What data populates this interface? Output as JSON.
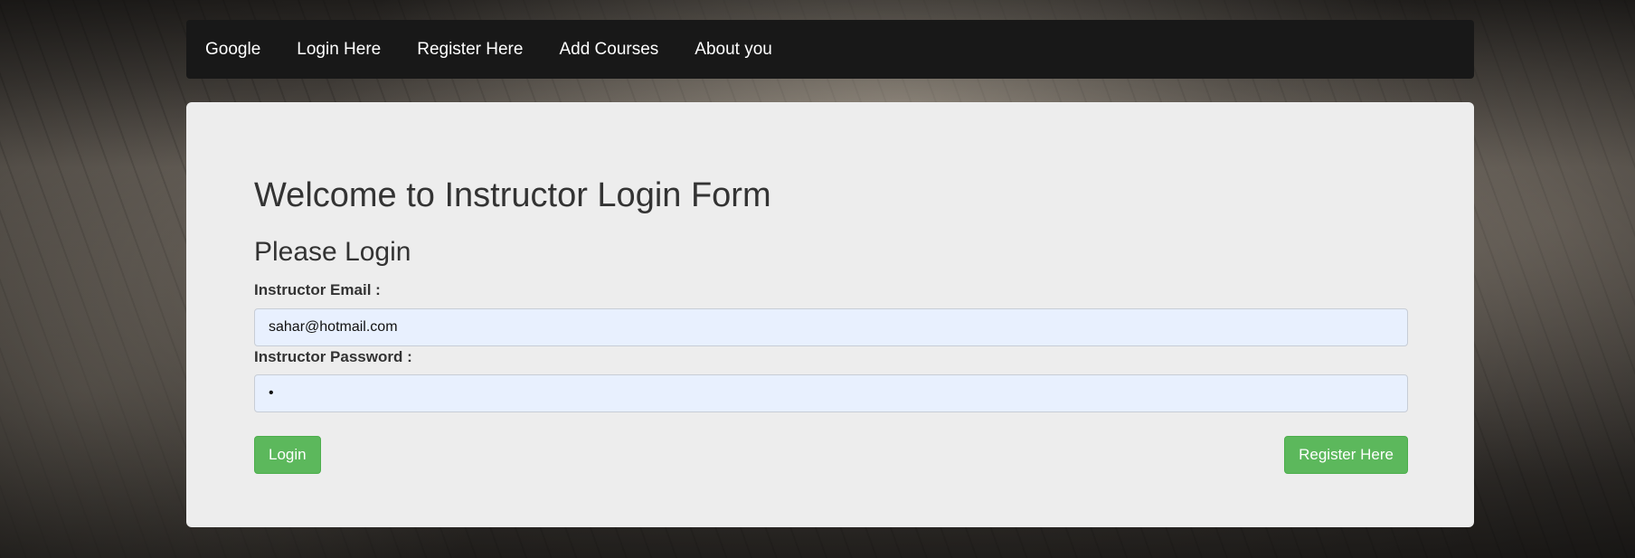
{
  "navbar": {
    "items": [
      {
        "label": "Google"
      },
      {
        "label": "Login Here"
      },
      {
        "label": "Register Here"
      },
      {
        "label": "Add Courses"
      },
      {
        "label": "About you"
      }
    ]
  },
  "form": {
    "title": "Welcome to Instructor Login Form",
    "subtitle": "Please Login",
    "email_label": "Instructor Email :",
    "email_value": "sahar@hotmail.com",
    "password_label": "Instructor Password :",
    "password_value": "•",
    "login_button": "Login",
    "register_button": "Register Here"
  },
  "colors": {
    "navbar_bg": "#181818",
    "panel_bg": "#ededed",
    "button_green": "#5cb85c",
    "input_bg": "#e8f0fe"
  }
}
